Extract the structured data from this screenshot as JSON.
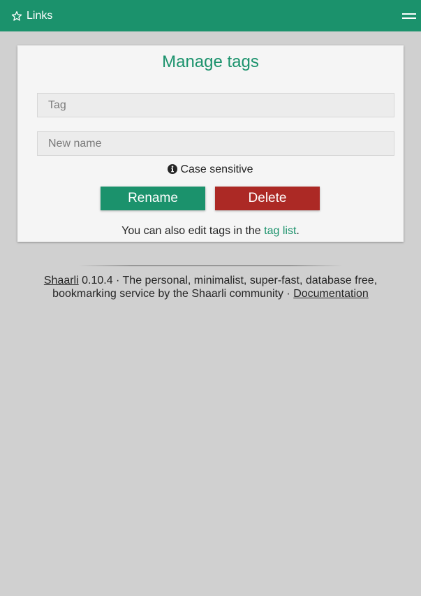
{
  "header": {
    "links_label": "Links",
    "icon": "star-outline-icon",
    "menu_icon": "hamburger-menu-icon"
  },
  "manage": {
    "title": "Manage tags",
    "tag_placeholder": "Tag",
    "new_name_placeholder": "New name",
    "case_hint_icon": "info-circle-icon",
    "case_hint": "Case sensitive",
    "rename_label": "Rename",
    "delete_label": "Delete",
    "also_prefix": "You can also edit tags in the",
    "tag_list_link": "tag list",
    "also_suffix": "."
  },
  "footer": {
    "shaarli_link": "Shaarli",
    "version_text": "0.10.4 · The personal, minimalist, super-fast, database free, bookmarking service by the Shaarli community ·",
    "docs_link": "Documentation"
  },
  "colors": {
    "accent": "#1b926c",
    "danger": "#ac2925",
    "background": "#d0d0d0",
    "panel": "#f5f5f5"
  }
}
